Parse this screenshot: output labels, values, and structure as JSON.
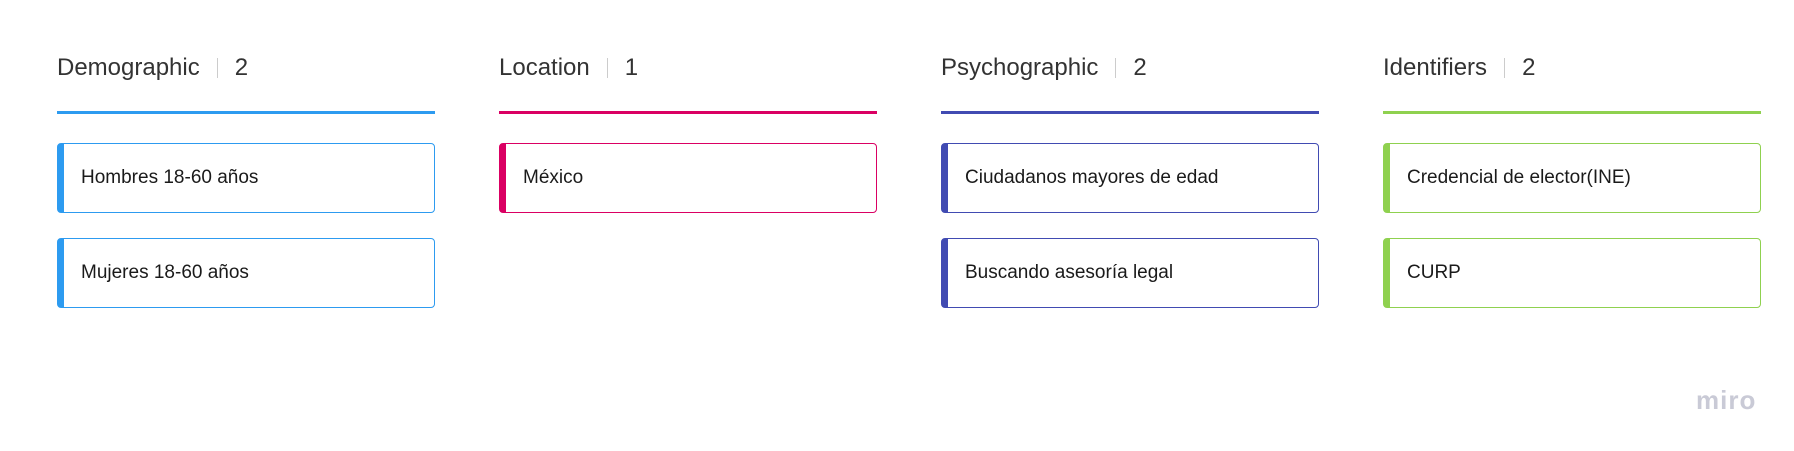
{
  "columns": [
    {
      "title": "Demographic",
      "count": "2",
      "color": "#2d9bf0",
      "items": [
        "Hombres 18-60 años",
        "Mujeres 18-60 años"
      ]
    },
    {
      "title": "Location",
      "count": "1",
      "color": "#da0063",
      "items": [
        "México"
      ]
    },
    {
      "title": "Psychographic",
      "count": "2",
      "color": "#414bb2",
      "items": [
        "Ciudadanos mayores de edad",
        "Buscando asesoría legal"
      ]
    },
    {
      "title": "Identifiers",
      "count": "2",
      "color": "#8fd14f",
      "items": [
        "Credencial de elector(INE)",
        "CURP"
      ]
    }
  ],
  "logo": "miro"
}
